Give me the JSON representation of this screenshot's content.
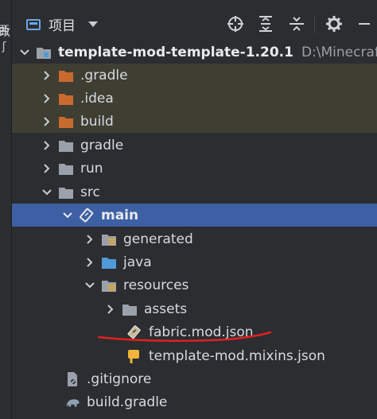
{
  "toolbar": {
    "title": "项目",
    "icons": [
      "project-view-icon",
      "dropdown-icon",
      "locate-icon",
      "expand-all-icon",
      "collapse-all-icon",
      "gear-icon",
      "hide-icon"
    ]
  },
  "left_strip": {
    "glyphs": [
      "亜",
      "ʃ",
      "改"
    ]
  },
  "tree": {
    "root": {
      "label": "template-mod-template-1.20.1",
      "path": "D:\\Minecraft\\"
    },
    "items": [
      {
        "label": ".gradle"
      },
      {
        "label": ".idea"
      },
      {
        "label": "build"
      },
      {
        "label": "gradle"
      },
      {
        "label": "run"
      },
      {
        "label": "src"
      },
      {
        "label": "main"
      },
      {
        "label": "generated"
      },
      {
        "label": "java"
      },
      {
        "label": "resources"
      },
      {
        "label": "assets"
      },
      {
        "label": "fabric.mod.json"
      },
      {
        "label": "template-mod.mixins.json"
      },
      {
        "label": ".gitignore"
      },
      {
        "label": "build.gradle"
      }
    ]
  },
  "colors": {
    "background": "#2b2d30",
    "selection": "#3d5fa3",
    "excluded_folder": "#c86a2e",
    "folder": "#9aa1aa",
    "source_folder": "#4f9ad8",
    "annotation": "#e02020"
  }
}
